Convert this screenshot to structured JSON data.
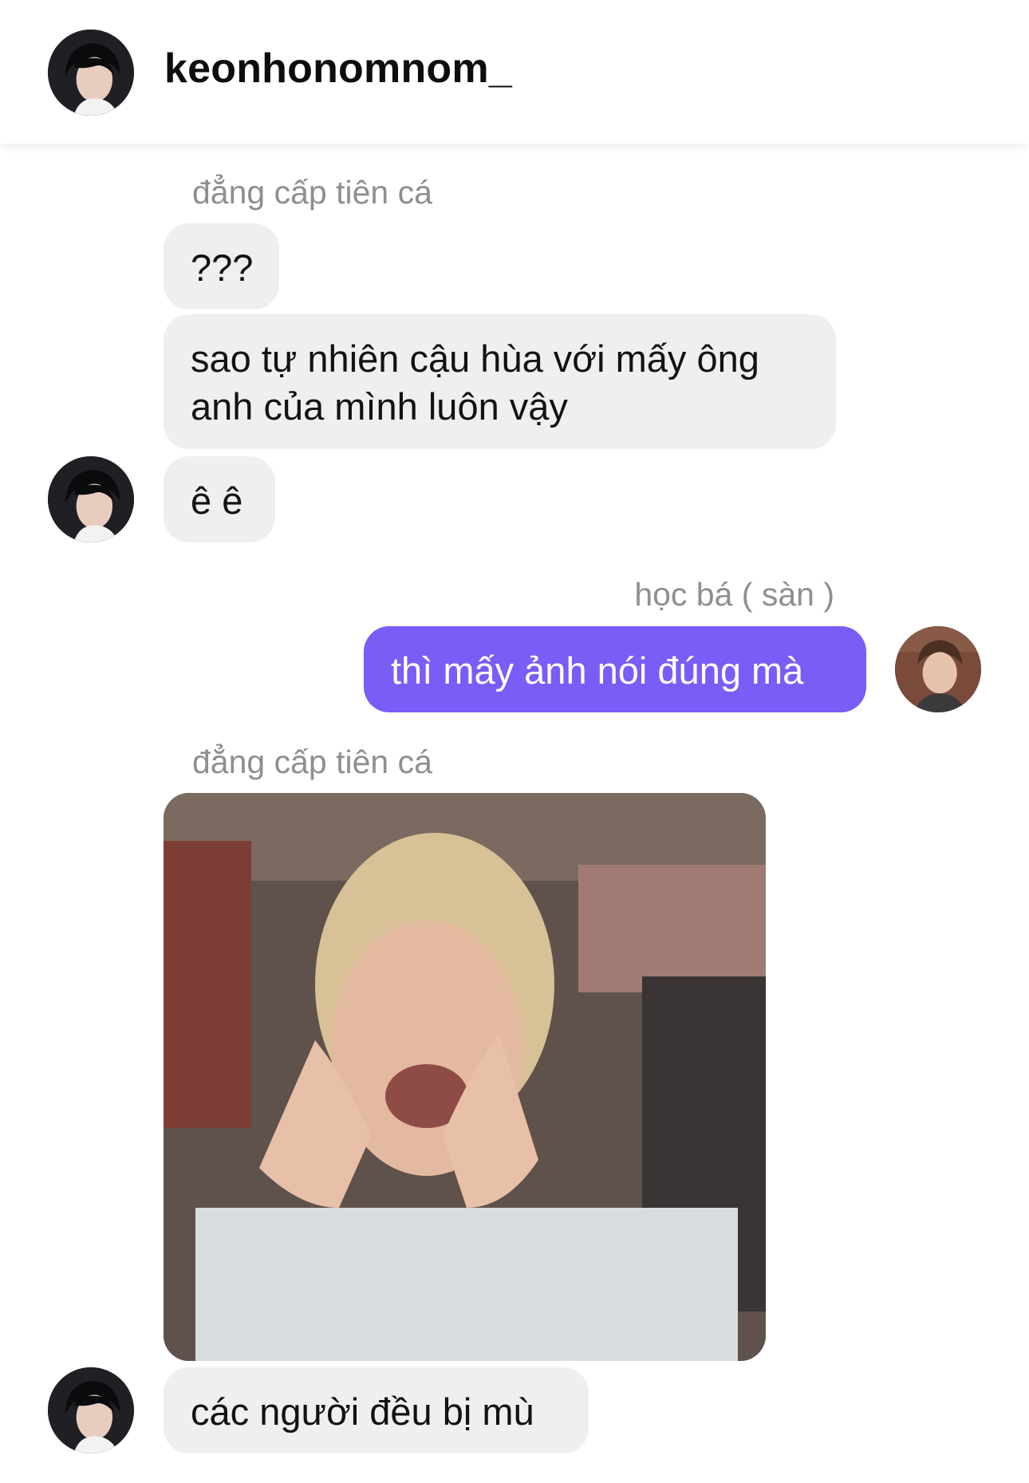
{
  "header": {
    "username": "keonhonomnom_",
    "avatar_icon": "user-avatar-icon"
  },
  "messages": [
    {
      "type": "label",
      "text": "đẳng cấp tiên cá"
    },
    {
      "type": "incoming",
      "text": "???"
    },
    {
      "type": "incoming",
      "text": "sao tự nhiên cậu hùa với mấy ông anh của mình luôn vậy"
    },
    {
      "type": "incoming",
      "text": "ê ê"
    },
    {
      "type": "label",
      "text": "học bá ( sàn )"
    },
    {
      "type": "outgoing",
      "text": "thì mấy ảnh nói đúng mà"
    },
    {
      "type": "label",
      "text": "đẳng cấp tiên cá"
    },
    {
      "type": "incoming-image",
      "icon": "photo-icon"
    },
    {
      "type": "incoming",
      "text": "các người đều bị mù"
    }
  ],
  "colors": {
    "outgoing_bubble": "#7a5cf7",
    "incoming_bubble": "#efeff1",
    "label_text": "#8e8e93"
  }
}
